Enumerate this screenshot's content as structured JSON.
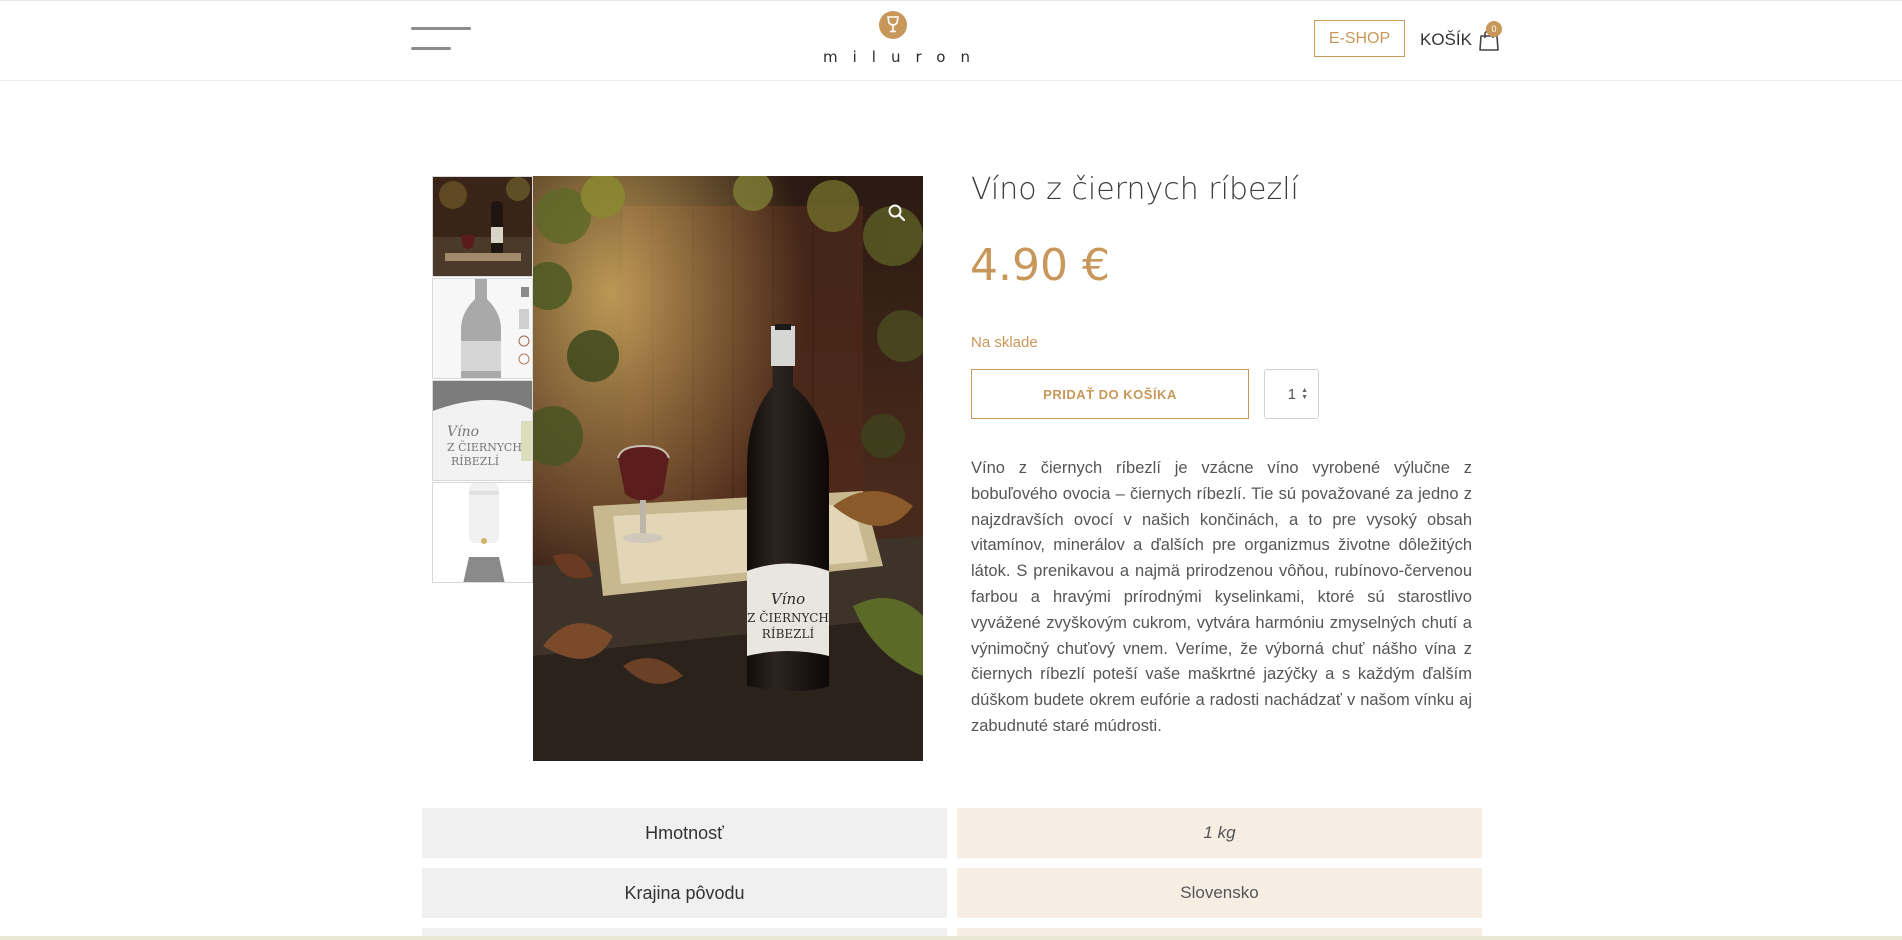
{
  "header": {
    "menu_icon": "hamburger-menu-icon",
    "logo_text": "miluron",
    "logo_icon": "wine-glass-icon",
    "eshop_label": "E-SHOP",
    "cart_label": "KOŠÍK",
    "cart_icon": "shopping-bag-icon",
    "cart_count": "0"
  },
  "gallery": {
    "thumbnails": [
      "product-scene-thumbnail",
      "bottle-back-thumbnail",
      "label-closeup-thumbnail",
      "bottle-neck-thumbnail"
    ],
    "zoom_icon": "magnifier-icon",
    "main_image_label_line1": "Víno",
    "main_image_label_line2": "Z ČIERNYCH",
    "main_image_label_line3": "RÍBEZLÍ"
  },
  "product": {
    "title": "Víno z čiernych ríbezlí",
    "price": "4.90 €",
    "stock": "Na sklade",
    "add_to_cart_label": "PRIDAŤ DO KOŠÍKA",
    "quantity": "1",
    "description": "Víno z čiernych ríbezlí je vzácne víno vyrobené výlučne z bobuľového ovocia – čiernych ríbezlí. Tie sú považované za jedno z najzdravších ovocí v našich končinách, a to pre vysoký obsah vitamínov, minerálov a ďalších pre organizmus životne dôležitých látok. S prenikavou a najmä prirodzenou vôňou, rubínovo-červenou farbou a hravými prírodnými kyselinkami, ktoré sú starostlivo vyvážené zvyškovým cukrom, vytvára harmóniu zmyselných chutí a výnimočný chuťový vnem. Veríme, že výborná chuť nášho vína z čiernych ríbezlí poteší vaše maškrtné jazýčky a s každým ďalším dúškom budete okrem eufórie a radosti nachádzať v našom vínku aj zabudnuté staré múdrosti."
  },
  "attributes": [
    {
      "label": "Hmotnosť",
      "value": "1 kg"
    },
    {
      "label": "Krajina pôvodu",
      "value": "Slovensko"
    }
  ],
  "colors": {
    "accent": "#c8975a",
    "attr_label_bg": "#f0f0f0",
    "attr_value_bg": "#f6eee3"
  }
}
